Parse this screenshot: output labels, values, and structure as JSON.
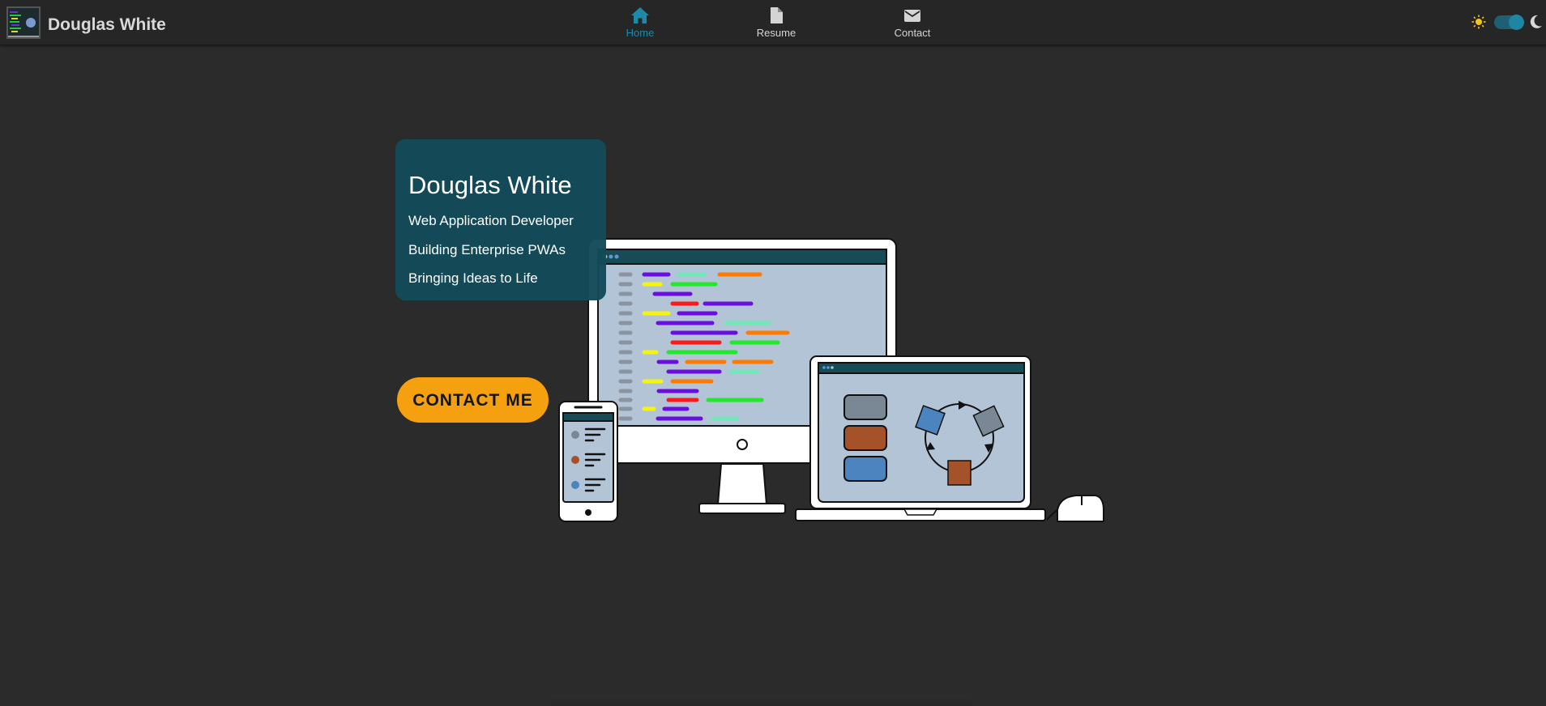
{
  "header": {
    "title": "Douglas White",
    "nav": [
      {
        "label": "Home",
        "icon": "home-icon",
        "active": true
      },
      {
        "label": "Resume",
        "icon": "document-icon",
        "active": false
      },
      {
        "label": "Contact",
        "icon": "mail-icon",
        "active": false
      }
    ],
    "theme_toggle": {
      "left_icon": "sun-icon",
      "right_icon": "moon-icon",
      "state": "dark"
    }
  },
  "hero": {
    "name": "Douglas White",
    "lines": [
      "Web Application Developer",
      "Building Enterprise PWAs",
      "Bringing Ideas to Life"
    ],
    "cta_label": "CONTACT ME"
  },
  "colors": {
    "accent": "#1f8aa8",
    "card_bg": "#144a5a",
    "cta_bg": "#f5a10f",
    "page_bg": "#2b2b2b"
  }
}
